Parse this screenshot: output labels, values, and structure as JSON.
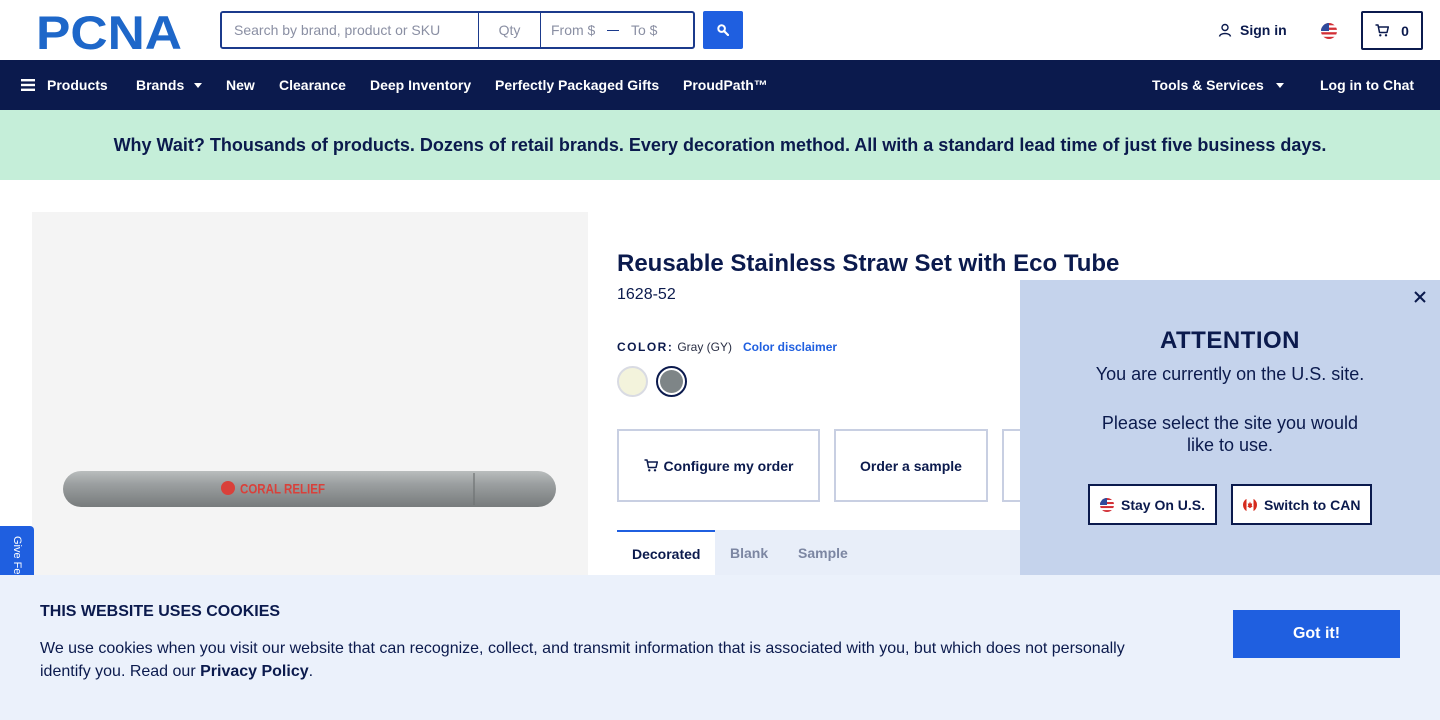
{
  "header": {
    "logo_text": "PCNA",
    "search_placeholder": "Search by brand, product or SKU",
    "qty_placeholder": "Qty",
    "price_from_placeholder": "From $",
    "price_to_placeholder": "To $",
    "sign_in_label": "Sign in",
    "cart_count": "0"
  },
  "nav": {
    "products": "Products",
    "brands": "Brands",
    "new": "New",
    "clearance": "Clearance",
    "deep_inventory": "Deep Inventory",
    "gifts": "Perfectly Packaged Gifts",
    "proudpath": "ProudPath™",
    "tools": "Tools & Services",
    "chat": "Log in to Chat"
  },
  "promo": {
    "text": "Why Wait? Thousands of products. Dozens of retail brands. Every decoration method. All with a standard lead time of just five business days."
  },
  "product": {
    "image_imprint": "CORAL RELIEF",
    "title": "Reusable Stainless Straw Set with Eco Tube",
    "sku": "1628-52",
    "color_label": "COLOR:",
    "color_value": "Gray (GY)",
    "color_disclaimer": "Color disclaimer",
    "swatches": [
      {
        "name": "Cream",
        "hex": "#f3f3dc"
      },
      {
        "name": "Gray",
        "hex": "#7e8587"
      }
    ],
    "configure_label": "Configure my order",
    "sample_label": "Order a sample",
    "tabs": [
      "Decorated",
      "Blank",
      "Sample"
    ]
  },
  "feedback": {
    "label": "Give Feedback"
  },
  "modal": {
    "title": "ATTENTION",
    "message1": "You are currently on the U.S. site.",
    "message2": "Please select the site you would like to use.",
    "stay_label": "Stay On U.S.",
    "switch_label": "Switch to CAN"
  },
  "cookie": {
    "title": "THIS WEBSITE USES COOKIES",
    "text": "We use cookies when you visit our website that can recognize, collect, and transmit information that is associated with you, but which does not personally identify you. Read our ",
    "link": "Privacy Policy",
    "suffix": ".",
    "button": "Got it!"
  },
  "colors": {
    "navy": "#0b1a4d",
    "accent_blue": "#1f5fe0",
    "promo_green": "#c5eed9",
    "modal_bg": "#c5d3ec",
    "cookie_bg": "#ebf1fb"
  }
}
